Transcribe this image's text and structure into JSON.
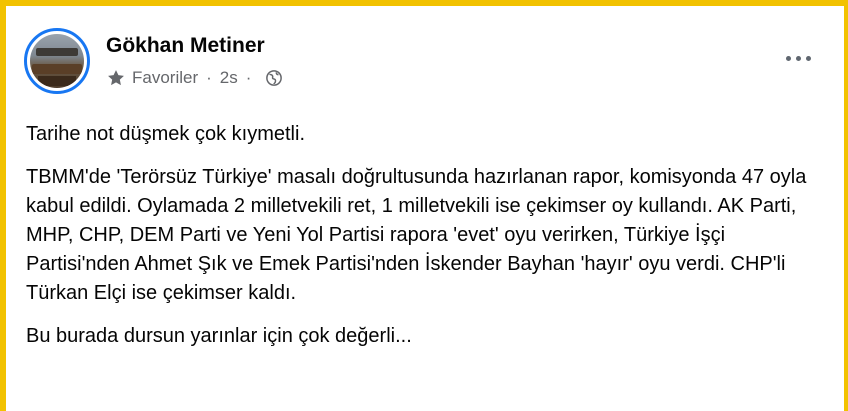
{
  "post": {
    "author": "Gökhan Metiner",
    "audience": "Favoriler",
    "time": "2s",
    "separator": "·",
    "paragraphs": [
      "Tarihe not düşmek çok kıymetli.",
      "TBMM'de 'Terörsüz Türkiye' masalı doğrultusunda hazırlanan rapor, komisyonda 47 oyla kabul edildi. Oylamada 2 milletvekili ret, 1 milletvekili ise çekimser oy kullandı. AK Parti, MHP, CHP, DEM Parti ve Yeni Yol Partisi rapora 'evet' oyu verirken, Türkiye İşçi Partisi'nden Ahmet Şık ve Emek Partisi'nden İskender Bayhan 'hayır' oyu verdi. CHP'li Türkan Elçi ise çekimser kaldı.",
      "Bu burada dursun yarınlar için çok değerli..."
    ]
  },
  "icons": {
    "audience": "star-icon",
    "privacy": "globe-icon",
    "menu": "more-options-icon"
  },
  "colors": {
    "frame": "#f2c200",
    "avatar_ring": "#1877f2",
    "meta_text": "#65676b"
  }
}
